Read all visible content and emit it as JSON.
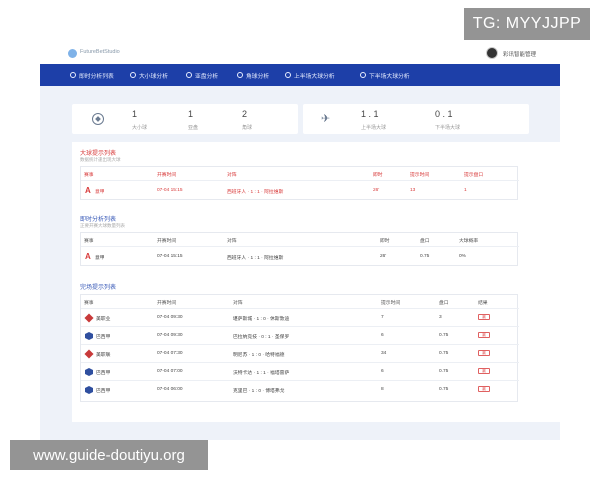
{
  "watermarks": {
    "top": "TG: MYYJJPP",
    "bottom": "www.guide-doutiyu.org"
  },
  "header": {
    "logo_text": "FutureBetStudio",
    "user_name": "彩讯智能管理"
  },
  "nav": {
    "items": [
      {
        "label": "即时分析列表",
        "icon": "ball-icon"
      },
      {
        "label": "大小球分析",
        "icon": "ball-icon"
      },
      {
        "label": "亚盘分析",
        "icon": "chart-icon"
      },
      {
        "label": "角球分析",
        "icon": "flag-icon"
      },
      {
        "label": "上半场大球分析",
        "icon": "rocket-icon"
      },
      {
        "label": "下半场大球分析",
        "icon": "rocket-icon"
      }
    ]
  },
  "stats_left": {
    "items": [
      {
        "value": "1",
        "label": "大小球"
      },
      {
        "value": "1",
        "label": "亚盘"
      },
      {
        "value": "2",
        "label": "角球"
      }
    ]
  },
  "stats_right": {
    "items": [
      {
        "value": "1 . 1",
        "label": "上半场大球"
      },
      {
        "value": "0 . 1",
        "label": "下半场大球"
      }
    ]
  },
  "section1": {
    "title": "大球提示列表",
    "subtitle": "数据统计逢出现大球",
    "columns": [
      "赛事",
      "开赛时间",
      "对阵",
      "即时",
      "提示时间",
      "提示盘口"
    ],
    "rows": [
      {
        "league": "意甲",
        "time": "07-04 15:15",
        "match": "西班牙人 · 1 : 1 · 阿拉维斯",
        "live": "26'",
        "tip_time": "13",
        "tip_line": "1"
      }
    ]
  },
  "section2": {
    "title": "即时分析列表",
    "subtitle": "正要开赛大球数量列表",
    "columns": [
      "赛事",
      "开赛时间",
      "对阵",
      "即时",
      "盘口",
      "大球概率"
    ],
    "rows": [
      {
        "league": "意甲",
        "time": "07-04 15:15",
        "match": "西班牙人 · 1 : 1 · 阿拉维斯",
        "live": "26'",
        "line": "0.75",
        "prob": "0%"
      }
    ]
  },
  "section3": {
    "title": "完场提示列表",
    "columns": [
      "赛事",
      "开赛时间",
      "对阵",
      "提示时间",
      "盘口",
      "结果"
    ],
    "rows": [
      {
        "league": "美职业",
        "logo": "c",
        "time": "07-04 09:30",
        "match": "堪萨斯城 · 1 : 0 · 休斯敦迪",
        "tip_time": "7",
        "line": "3",
        "result": "赢"
      },
      {
        "league": "巴西甲",
        "logo": "b",
        "time": "07-04 09:30",
        "match": "巴拉纳竞技 · 0 : 1 · 圣保罗",
        "tip_time": "6",
        "line": "0.75",
        "result": "赢"
      },
      {
        "league": "美职联",
        "logo": "c",
        "time": "07-04 07:30",
        "match": "明尼苏 · 1 : 0 · 哈特福德",
        "tip_time": "34",
        "line": "0.75",
        "result": "赢"
      },
      {
        "league": "巴西甲",
        "logo": "b",
        "time": "07-04 07:00",
        "match": "沃特卡达 · 1 : 1 · 福塔雷萨",
        "tip_time": "6",
        "line": "0.75",
        "result": "赢"
      },
      {
        "league": "巴西甲",
        "logo": "b",
        "time": "07-04 06:00",
        "match": "克里巴 · 1 : 0 · 博塔弗戈",
        "tip_time": "8",
        "line": "0.75",
        "result": "赢"
      }
    ]
  },
  "colors": {
    "nav": "#1d3fa8",
    "alert_red": "#d83a3a",
    "section_blue": "#3a5bb8",
    "background": "#eef2f9"
  }
}
